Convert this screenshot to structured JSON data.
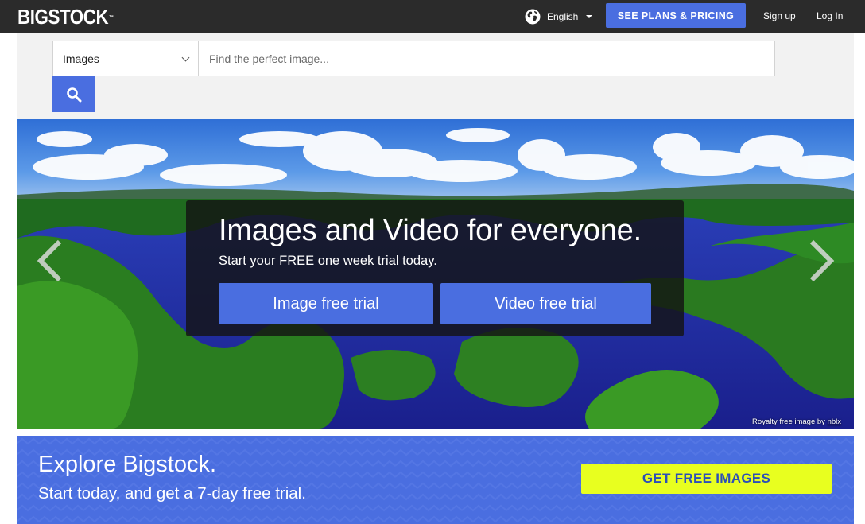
{
  "header": {
    "logo_text": "BIGSTOCK",
    "logo_mark": "™",
    "language": "English",
    "plans_button": "SEE PLANS & PRICING",
    "signup": "Sign up",
    "login": "Log In"
  },
  "search": {
    "type_selected": "Images",
    "placeholder": "Find the perfect image...",
    "button_icon": "search-icon"
  },
  "hero": {
    "title": "Images and Video for everyone.",
    "subtitle": "Start your FREE one week trial today.",
    "image_trial_button": "Image free trial",
    "video_trial_button": "Video free trial",
    "credit_prefix": "Royalty free image by",
    "credit_author": "nblx",
    "prev_icon": "chevron-left-icon",
    "next_icon": "chevron-right-icon"
  },
  "explore": {
    "title": "Explore Bigstock.",
    "subtitle": "Start today, and get a 7-day free trial.",
    "cta": "GET FREE IMAGES"
  },
  "colors": {
    "topbar": "#2b2b2b",
    "brand_blue": "#4a6ee0",
    "cta_yellow": "#e8ff1f"
  }
}
